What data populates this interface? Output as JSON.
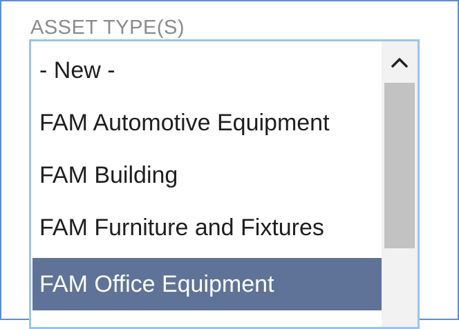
{
  "field": {
    "label": "ASSET TYPE(S)"
  },
  "listbox": {
    "options": [
      {
        "label": "- New -"
      },
      {
        "label": "FAM Automotive Equipment"
      },
      {
        "label": "FAM Building"
      },
      {
        "label": "FAM Furniture and Fixtures"
      },
      {
        "label": "FAM Office Equipment",
        "selected": true
      }
    ],
    "scroll_up_icon": "chevron-up-icon"
  },
  "colors": {
    "frame_border": "#5b8ed0",
    "listbox_border": "#9dc3ea",
    "selected_background": "#5f7398",
    "selected_text": "#ffffff",
    "label_text": "#8a8a8a",
    "scrollbar_track": "#f2f2f2",
    "scrollbar_thumb": "#c2c2c2"
  }
}
